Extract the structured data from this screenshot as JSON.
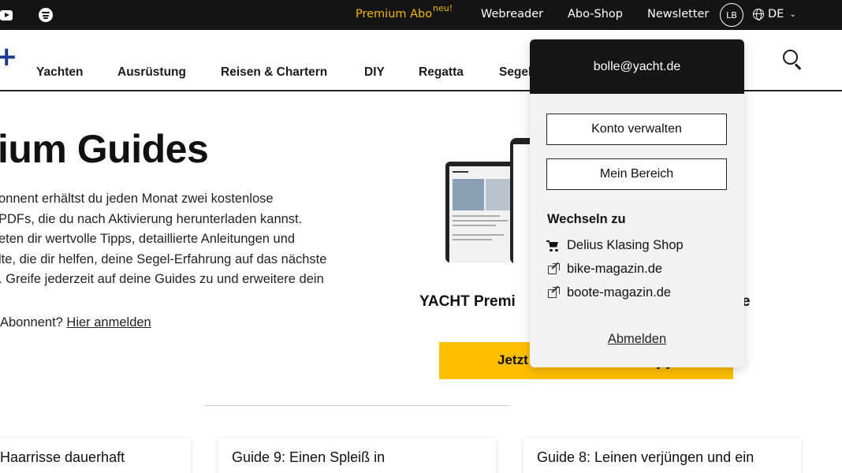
{
  "topbar": {
    "premium_abo": "Premium Abo",
    "premium_badge": "neu!",
    "webreader": "Webreader",
    "abo_shop": "Abo-Shop",
    "newsletter": "Newsletter",
    "avatar_initials": "LB",
    "language": "DE",
    "accent_color": "#f5b800"
  },
  "nav": {
    "items": [
      "Yachten",
      "Ausrüstung",
      "Reisen & Chartern",
      "DIY",
      "Regatta",
      "Segel"
    ]
  },
  "main": {
    "title": "ium Guides",
    "intro_lines": [
      "onnent erhältst du jeden Monat zwei kostenlose",
      "PDFs, die du nach Aktivierung herunterladen kannst.",
      "eten dir wertvolle Tipps, detaillierte Anleitungen und",
      "lte, die dir helfen, deine Segel-Erfahrung auf das nächste",
      ". Greife jederzeit auf deine Guides zu und erweitere dein"
    ],
    "login_hint_prefix": "Abonnent? ",
    "login_hint_link": "Hier anmelden"
  },
  "promo": {
    "title": "YACHT Premi",
    "title_tail": "e",
    "cta_label": "Jetzt",
    "cta_color": "#ffbe00"
  },
  "cards": [
    {
      "title": "Haarrisse dauerhaft"
    },
    {
      "title": "Guide 9: Einen Spleiß in"
    },
    {
      "title": "Guide 8: Leinen verjüngen und ein"
    }
  ],
  "account_menu": {
    "email": "bolle@yacht.de",
    "manage_account": "Konto verwalten",
    "my_area": "Mein Bereich",
    "switch_to": "Wechseln zu",
    "links": [
      {
        "label": "Delius Klasing Shop",
        "icon": "cart-icon"
      },
      {
        "label": "bike-magazin.de",
        "icon": "external-link-icon"
      },
      {
        "label": "boote-magazin.de",
        "icon": "external-link-icon"
      }
    ],
    "logout": "Abmelden"
  }
}
